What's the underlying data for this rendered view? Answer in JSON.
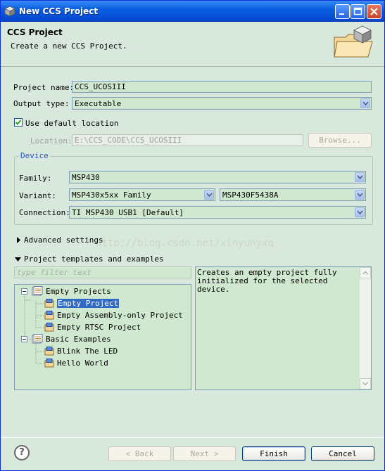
{
  "window": {
    "title": "New CCS Project"
  },
  "header": {
    "title": "CCS Project",
    "subtitle": "Create a new CCS Project."
  },
  "form": {
    "project_name_label": "Project name:",
    "project_name_value": "CCS_UCOSIII",
    "output_type_label": "Output type:",
    "output_type_value": "Executable",
    "use_default_location_label": "Use default location",
    "use_default_location_checked": true,
    "location_label": "Location:",
    "location_value": "E:\\CCS_CODE\\CCS_UCOSIII",
    "browse_label": "Browse..."
  },
  "device": {
    "group_title": "Device",
    "family_label": "Family:",
    "family_value": "MSP430",
    "variant_label": "Variant:",
    "variant_family_value": "MSP430x5xx Family",
    "variant_device_value": "MSP430F5438A",
    "connection_label": "Connection:",
    "connection_value": "TI MSP430 USB1 [Default]"
  },
  "sections": {
    "advanced_settings": "Advanced settings",
    "templates": "Project templates and examples"
  },
  "watermark": "http://blog.csdn.net/xinyunyxq",
  "templates": {
    "filter_placeholder": "type filter text",
    "tree": [
      {
        "label": "Empty Projects",
        "level": 0,
        "expanded": true
      },
      {
        "label": "Empty Project",
        "level": 1,
        "selected": true
      },
      {
        "label": "Empty Assembly-only Project",
        "level": 1
      },
      {
        "label": "Empty RTSC Project",
        "level": 1
      },
      {
        "label": "Basic Examples",
        "level": 0,
        "expanded": true
      },
      {
        "label": "Blink The LED",
        "level": 1
      },
      {
        "label": "Hello World",
        "level": 1
      }
    ],
    "description": "Creates an empty project fully initialized for the selected device."
  },
  "footer": {
    "help": "?",
    "back_label": "< Back",
    "next_label": "Next >",
    "finish_label": "Finish",
    "cancel_label": "Cancel"
  },
  "colors": {
    "title_bar": "#0a5fe0",
    "panel_bg": "#d8e8dc",
    "selection": "#316ac5",
    "group_title": "#2a55c8"
  }
}
